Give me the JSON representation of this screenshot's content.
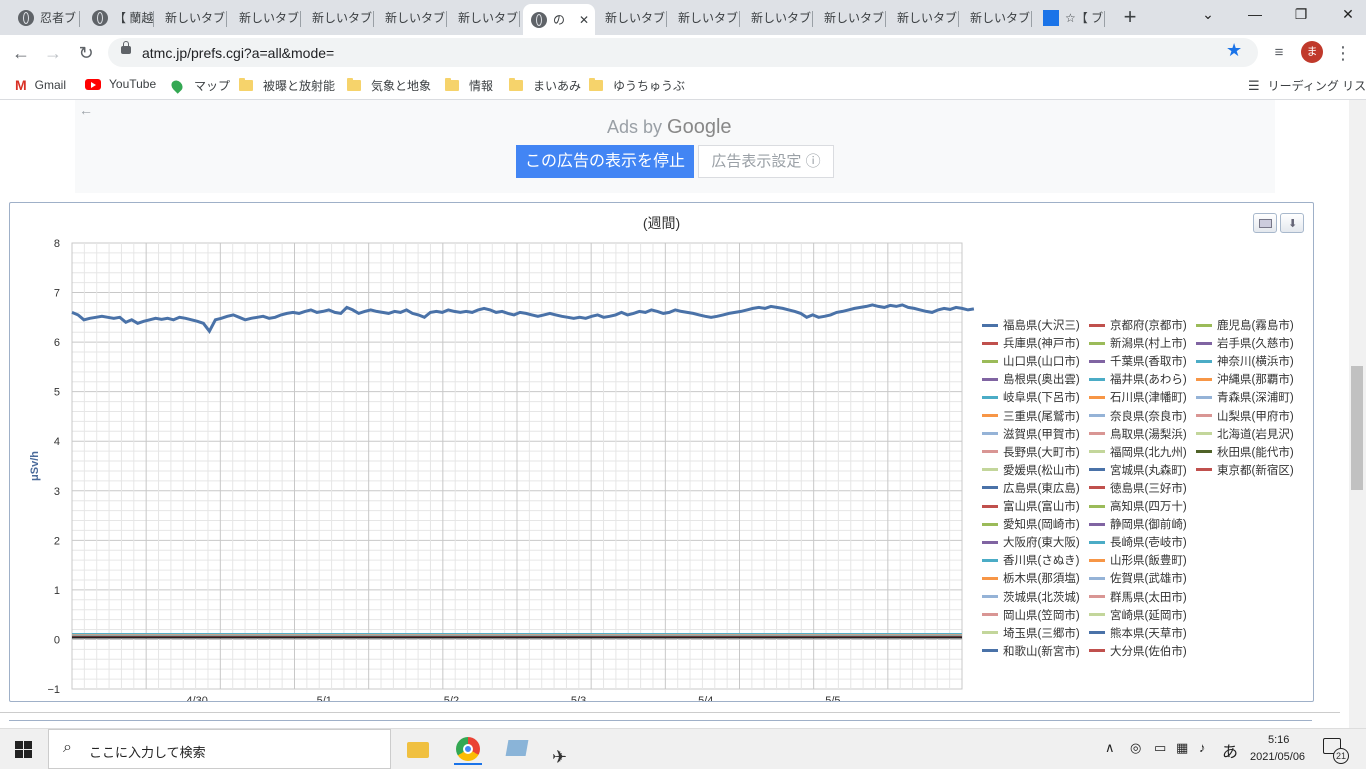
{
  "tabs": [
    {
      "title": "忍者ブ"
    },
    {
      "title": "【 蘭越"
    },
    {
      "title": "新しいタブ"
    },
    {
      "title": "新しいタブ"
    },
    {
      "title": "新しいタブ"
    },
    {
      "title": "新しいタブ"
    },
    {
      "title": "新しいタブ"
    },
    {
      "title": "の"
    },
    {
      "title": "新しいタブ"
    },
    {
      "title": "新しいタブ"
    },
    {
      "title": "新しいタブ"
    },
    {
      "title": "新しいタブ"
    },
    {
      "title": "新しいタブ"
    },
    {
      "title": "新しいタブ"
    },
    {
      "title": "☆【 ブ"
    }
  ],
  "toolbar": {
    "url": "atmc.jp/prefs.cgi?a=all&mode=",
    "profile_initial": "ま"
  },
  "bookmarks": [
    "Gmail",
    "YouTube",
    "マップ",
    "被曝と放射能",
    "気象と地象",
    "情報",
    "まいあみ",
    "ゆうちゅうぶ"
  ],
  "reading_list": "リーディング リスト",
  "ad": {
    "ads_by": "Ads by",
    "google": "Google",
    "stop_label": "この広告の表示を停止",
    "settings_label": "広告表示設定 ⓘ"
  },
  "chart": {
    "title": "(週間)"
  },
  "chart_data": {
    "type": "line",
    "title": "(週間)",
    "ylabel": "μSv/h",
    "xlabel": "",
    "ylim": [
      -1,
      8
    ],
    "yticks": [
      "8",
      "7",
      "6",
      "5",
      "4",
      "3",
      "2",
      "1",
      "0",
      "−1"
    ],
    "xticks": [
      "4/30",
      "5/1",
      "5/2",
      "5/3",
      "5/4",
      "5/5"
    ],
    "x_count": 150,
    "grid": true,
    "legend_position": "right",
    "series": [
      {
        "name": "福島県(大沢三)",
        "color": "#4a72a8",
        "values": [
          6.6,
          6.55,
          6.45,
          6.48,
          6.5,
          6.52,
          6.5,
          6.48,
          6.5,
          6.4,
          6.45,
          6.38,
          6.42,
          6.45,
          6.48,
          6.46,
          6.48,
          6.45,
          6.5,
          6.48,
          6.45,
          6.42,
          6.38,
          6.22,
          6.45,
          6.48,
          6.52,
          6.55,
          6.5,
          6.45,
          6.48,
          6.5,
          6.52,
          6.48,
          6.5,
          6.55,
          6.58,
          6.6,
          6.58,
          6.62,
          6.65,
          6.6,
          6.62,
          6.65,
          6.6,
          6.58,
          6.7,
          6.65,
          6.58,
          6.62,
          6.65,
          6.62,
          6.6,
          6.58,
          6.62,
          6.6,
          6.65,
          6.58,
          6.55,
          6.5,
          6.6,
          6.62,
          6.6,
          6.65,
          6.62,
          6.6,
          6.62,
          6.6,
          6.65,
          6.68,
          6.65,
          6.6,
          6.62,
          6.58,
          6.55,
          6.6,
          6.58,
          6.55,
          6.52,
          6.55,
          6.58,
          6.55,
          6.52,
          6.5,
          6.48,
          6.5,
          6.48,
          6.52,
          6.55,
          6.5,
          6.52,
          6.55,
          6.6,
          6.55,
          6.58,
          6.62,
          6.6,
          6.65,
          6.62,
          6.58,
          6.6,
          6.65,
          6.62,
          6.6,
          6.58,
          6.55,
          6.52,
          6.5,
          6.52,
          6.55,
          6.58,
          6.6,
          6.62,
          6.65,
          6.68,
          6.7,
          6.68,
          6.72,
          6.7,
          6.68,
          6.65,
          6.62,
          6.58,
          6.5,
          6.55,
          6.5,
          6.52,
          6.55,
          6.6,
          6.62,
          6.65,
          6.68,
          6.7,
          6.72,
          6.75,
          6.72,
          6.7,
          6.74,
          6.72,
          6.75,
          6.7,
          6.68,
          6.65,
          6.62,
          6.6,
          6.65,
          6.68,
          6.66,
          6.7,
          6.68,
          6.65,
          6.67
        ]
      },
      {
        "name": "京都府(京都市)",
        "color": "#c0504d",
        "level": 0.06
      },
      {
        "name": "鹿児島(霧島市)",
        "color": "#9bbb59",
        "level": 0.1
      },
      {
        "name": "兵庫県(神戸市)",
        "color": "#c0504d",
        "level": 0.1
      },
      {
        "name": "新潟県(村上市)",
        "color": "#9bbb59",
        "level": 0.08
      },
      {
        "name": "岩手県(久慈市)",
        "color": "#8064a2",
        "level": 0.05
      },
      {
        "name": "山口県(山口市)",
        "color": "#9bbb59",
        "level": 0.08
      },
      {
        "name": "千葉県(香取市)",
        "color": "#8064a2",
        "level": 0.06
      },
      {
        "name": "神奈川(横浜市)",
        "color": "#4bacc6",
        "level": 0.05
      },
      {
        "name": "島根県(奥出雲)",
        "color": "#8064a2",
        "level": 0.07
      },
      {
        "name": "福井県(あわら)",
        "color": "#4bacc6",
        "level": 0.1
      },
      {
        "name": "沖縄県(那覇市)",
        "color": "#f79646",
        "level": 0.04
      },
      {
        "name": "岐阜県(下呂市)",
        "color": "#4bacc6",
        "level": 0.11
      },
      {
        "name": "石川県(津幡町)",
        "color": "#f79646",
        "level": 0.08
      },
      {
        "name": "青森県(深浦町)",
        "color": "#95b3d7",
        "level": 0.06
      },
      {
        "name": "三重県(尾鷲市)",
        "color": "#f79646",
        "level": 0.07
      },
      {
        "name": "奈良県(奈良市)",
        "color": "#95b3d7",
        "level": 0.08
      },
      {
        "name": "山梨県(甲府市)",
        "color": "#d99694",
        "level": 0.06
      },
      {
        "name": "滋賀県(甲賀市)",
        "color": "#95b3d7",
        "level": 0.07
      },
      {
        "name": "鳥取県(湯梨浜)",
        "color": "#d99694",
        "level": 0.09
      },
      {
        "name": "北海道(岩見沢)",
        "color": "#c3d69b",
        "level": 0.05
      },
      {
        "name": "長野県(大町市)",
        "color": "#d99694",
        "level": 0.08
      },
      {
        "name": "福岡県(北九州)",
        "color": "#c3d69b",
        "level": 0.06
      },
      {
        "name": "秋田県(能代市)",
        "color": "#4f6228",
        "level": 0.05
      },
      {
        "name": "愛媛県(松山市)",
        "color": "#c3d69b",
        "level": 0.07
      },
      {
        "name": "宮城県(丸森町)",
        "color": "#4a72a8",
        "level": 0.06
      },
      {
        "name": "東京都(新宿区)",
        "color": "#c0504d",
        "level": 0.04
      },
      {
        "name": "広島県(東広島)",
        "color": "#4a72a8",
        "level": 0.06
      },
      {
        "name": "徳島県(三好市)",
        "color": "#c0504d",
        "level": 0.05
      },
      {
        "name": "富山県(富山市)",
        "color": "#c0504d",
        "level": 0.07
      },
      {
        "name": "高知県(四万十)",
        "color": "#9bbb59",
        "level": 0.04
      },
      {
        "name": "愛知県(岡崎市)",
        "color": "#9bbb59",
        "level": 0.07
      },
      {
        "name": "静岡県(御前崎)",
        "color": "#8064a2",
        "level": 0.06
      },
      {
        "name": "大阪府(東大阪)",
        "color": "#8064a2",
        "level": 0.07
      },
      {
        "name": "長崎県(壱岐市)",
        "color": "#4bacc6",
        "level": 0.05
      },
      {
        "name": "香川県(さぬき)",
        "color": "#4bacc6",
        "level": 0.09
      },
      {
        "name": "山形県(飯豊町)",
        "color": "#f79646",
        "level": 0.07
      },
      {
        "name": "栃木県(那須塩)",
        "color": "#f79646",
        "level": 0.09
      },
      {
        "name": "佐賀県(武雄市)",
        "color": "#95b3d7",
        "level": 0.05
      },
      {
        "name": "茨城県(北茨城)",
        "color": "#95b3d7",
        "level": 0.08
      },
      {
        "name": "群馬県(太田市)",
        "color": "#d99694",
        "level": 0.06
      },
      {
        "name": "岡山県(笠岡市)",
        "color": "#d99694",
        "level": 0.07
      },
      {
        "name": "宮崎県(延岡市)",
        "color": "#c3d69b",
        "level": 0.06
      },
      {
        "name": "埼玉県(三郷市)",
        "color": "#c3d69b",
        "level": 0.07
      },
      {
        "name": "熊本県(天草市)",
        "color": "#4a72a8",
        "level": 0.05
      },
      {
        "name": "和歌山(新宮市)",
        "color": "#4a72a8",
        "level": 0.06
      },
      {
        "name": "大分県(佐伯市)",
        "color": "#c0504d",
        "level": 0.05
      }
    ]
  },
  "taskbar": {
    "search_placeholder": "ここに入力して検索",
    "time": "5:16",
    "date": "2021/05/06",
    "ime": "あ",
    "notifications": "21"
  }
}
